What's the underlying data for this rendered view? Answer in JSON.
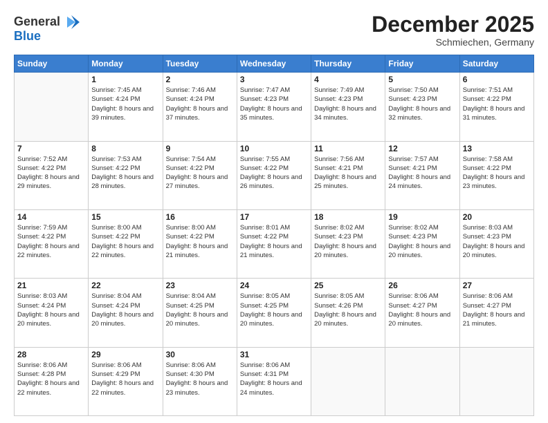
{
  "header": {
    "logo_line1": "General",
    "logo_line2": "Blue",
    "month": "December 2025",
    "location": "Schmiechen, Germany"
  },
  "days_of_week": [
    "Sunday",
    "Monday",
    "Tuesday",
    "Wednesday",
    "Thursday",
    "Friday",
    "Saturday"
  ],
  "weeks": [
    [
      {
        "day": "",
        "sunrise": "",
        "sunset": "",
        "daylight": ""
      },
      {
        "day": "1",
        "sunrise": "Sunrise: 7:45 AM",
        "sunset": "Sunset: 4:24 PM",
        "daylight": "Daylight: 8 hours and 39 minutes."
      },
      {
        "day": "2",
        "sunrise": "Sunrise: 7:46 AM",
        "sunset": "Sunset: 4:24 PM",
        "daylight": "Daylight: 8 hours and 37 minutes."
      },
      {
        "day": "3",
        "sunrise": "Sunrise: 7:47 AM",
        "sunset": "Sunset: 4:23 PM",
        "daylight": "Daylight: 8 hours and 35 minutes."
      },
      {
        "day": "4",
        "sunrise": "Sunrise: 7:49 AM",
        "sunset": "Sunset: 4:23 PM",
        "daylight": "Daylight: 8 hours and 34 minutes."
      },
      {
        "day": "5",
        "sunrise": "Sunrise: 7:50 AM",
        "sunset": "Sunset: 4:23 PM",
        "daylight": "Daylight: 8 hours and 32 minutes."
      },
      {
        "day": "6",
        "sunrise": "Sunrise: 7:51 AM",
        "sunset": "Sunset: 4:22 PM",
        "daylight": "Daylight: 8 hours and 31 minutes."
      }
    ],
    [
      {
        "day": "7",
        "sunrise": "Sunrise: 7:52 AM",
        "sunset": "Sunset: 4:22 PM",
        "daylight": "Daylight: 8 hours and 29 minutes."
      },
      {
        "day": "8",
        "sunrise": "Sunrise: 7:53 AM",
        "sunset": "Sunset: 4:22 PM",
        "daylight": "Daylight: 8 hours and 28 minutes."
      },
      {
        "day": "9",
        "sunrise": "Sunrise: 7:54 AM",
        "sunset": "Sunset: 4:22 PM",
        "daylight": "Daylight: 8 hours and 27 minutes."
      },
      {
        "day": "10",
        "sunrise": "Sunrise: 7:55 AM",
        "sunset": "Sunset: 4:22 PM",
        "daylight": "Daylight: 8 hours and 26 minutes."
      },
      {
        "day": "11",
        "sunrise": "Sunrise: 7:56 AM",
        "sunset": "Sunset: 4:21 PM",
        "daylight": "Daylight: 8 hours and 25 minutes."
      },
      {
        "day": "12",
        "sunrise": "Sunrise: 7:57 AM",
        "sunset": "Sunset: 4:21 PM",
        "daylight": "Daylight: 8 hours and 24 minutes."
      },
      {
        "day": "13",
        "sunrise": "Sunrise: 7:58 AM",
        "sunset": "Sunset: 4:22 PM",
        "daylight": "Daylight: 8 hours and 23 minutes."
      }
    ],
    [
      {
        "day": "14",
        "sunrise": "Sunrise: 7:59 AM",
        "sunset": "Sunset: 4:22 PM",
        "daylight": "Daylight: 8 hours and 22 minutes."
      },
      {
        "day": "15",
        "sunrise": "Sunrise: 8:00 AM",
        "sunset": "Sunset: 4:22 PM",
        "daylight": "Daylight: 8 hours and 22 minutes."
      },
      {
        "day": "16",
        "sunrise": "Sunrise: 8:00 AM",
        "sunset": "Sunset: 4:22 PM",
        "daylight": "Daylight: 8 hours and 21 minutes."
      },
      {
        "day": "17",
        "sunrise": "Sunrise: 8:01 AM",
        "sunset": "Sunset: 4:22 PM",
        "daylight": "Daylight: 8 hours and 21 minutes."
      },
      {
        "day": "18",
        "sunrise": "Sunrise: 8:02 AM",
        "sunset": "Sunset: 4:23 PM",
        "daylight": "Daylight: 8 hours and 20 minutes."
      },
      {
        "day": "19",
        "sunrise": "Sunrise: 8:02 AM",
        "sunset": "Sunset: 4:23 PM",
        "daylight": "Daylight: 8 hours and 20 minutes."
      },
      {
        "day": "20",
        "sunrise": "Sunrise: 8:03 AM",
        "sunset": "Sunset: 4:23 PM",
        "daylight": "Daylight: 8 hours and 20 minutes."
      }
    ],
    [
      {
        "day": "21",
        "sunrise": "Sunrise: 8:03 AM",
        "sunset": "Sunset: 4:24 PM",
        "daylight": "Daylight: 8 hours and 20 minutes."
      },
      {
        "day": "22",
        "sunrise": "Sunrise: 8:04 AM",
        "sunset": "Sunset: 4:24 PM",
        "daylight": "Daylight: 8 hours and 20 minutes."
      },
      {
        "day": "23",
        "sunrise": "Sunrise: 8:04 AM",
        "sunset": "Sunset: 4:25 PM",
        "daylight": "Daylight: 8 hours and 20 minutes."
      },
      {
        "day": "24",
        "sunrise": "Sunrise: 8:05 AM",
        "sunset": "Sunset: 4:25 PM",
        "daylight": "Daylight: 8 hours and 20 minutes."
      },
      {
        "day": "25",
        "sunrise": "Sunrise: 8:05 AM",
        "sunset": "Sunset: 4:26 PM",
        "daylight": "Daylight: 8 hours and 20 minutes."
      },
      {
        "day": "26",
        "sunrise": "Sunrise: 8:06 AM",
        "sunset": "Sunset: 4:27 PM",
        "daylight": "Daylight: 8 hours and 20 minutes."
      },
      {
        "day": "27",
        "sunrise": "Sunrise: 8:06 AM",
        "sunset": "Sunset: 4:27 PM",
        "daylight": "Daylight: 8 hours and 21 minutes."
      }
    ],
    [
      {
        "day": "28",
        "sunrise": "Sunrise: 8:06 AM",
        "sunset": "Sunset: 4:28 PM",
        "daylight": "Daylight: 8 hours and 22 minutes."
      },
      {
        "day": "29",
        "sunrise": "Sunrise: 8:06 AM",
        "sunset": "Sunset: 4:29 PM",
        "daylight": "Daylight: 8 hours and 22 minutes."
      },
      {
        "day": "30",
        "sunrise": "Sunrise: 8:06 AM",
        "sunset": "Sunset: 4:30 PM",
        "daylight": "Daylight: 8 hours and 23 minutes."
      },
      {
        "day": "31",
        "sunrise": "Sunrise: 8:06 AM",
        "sunset": "Sunset: 4:31 PM",
        "daylight": "Daylight: 8 hours and 24 minutes."
      },
      {
        "day": "",
        "sunrise": "",
        "sunset": "",
        "daylight": ""
      },
      {
        "day": "",
        "sunrise": "",
        "sunset": "",
        "daylight": ""
      },
      {
        "day": "",
        "sunrise": "",
        "sunset": "",
        "daylight": ""
      }
    ]
  ]
}
